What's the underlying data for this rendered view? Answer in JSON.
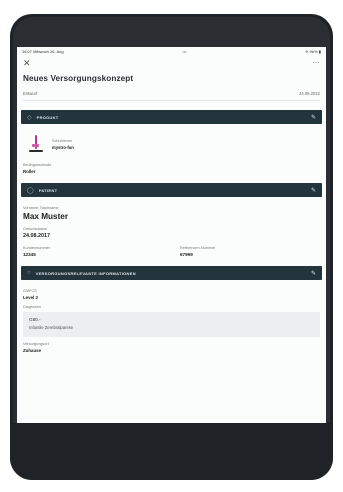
{
  "status_bar": {
    "left": "16:07  Mittwoch 26. Aug",
    "center": "•••",
    "right": "✈ 96% ▮"
  },
  "top_bar": {
    "close_glyph": "✕",
    "menu_glyph": "···"
  },
  "header": {
    "title": "Neues Versorgungskonzept",
    "left_meta": "Entwurf",
    "right_meta": "24.08.2022"
  },
  "sections": {
    "product": {
      "title": "PRODUKT",
      "icon": "cube-icon",
      "edit_glyph": "✎"
    },
    "patient": {
      "title": "PATIENT",
      "icon": "person-icon",
      "edit_glyph": "✎"
    },
    "care": {
      "title": "VERSORGUNGSRELEVANTE INFORMATIONEN",
      "icon": "info-icon",
      "edit_glyph": "✎"
    }
  },
  "product": {
    "label": "Schuhrexen",
    "value": "mystro-fun",
    "field_label": "Bedingunsimode",
    "field_value": "Roller"
  },
  "patient": {
    "name_label": "Vorname, Nachname",
    "name_value": "Max Muster",
    "birth_label": "Geburtsdatum",
    "birth_value": "24.08.2017",
    "id_label": "Kundennummer",
    "id_value": "12345",
    "ref_label": "Referenzen-Nummer",
    "ref_value": "67999"
  },
  "care": {
    "level_label": "GMFCS",
    "level_value": "Level 2",
    "diag_label": "Diagnosen",
    "diag_line1": "G80.-",
    "diag_line2": "Infantile Zerebralparese",
    "place_label": "Versorgungsort",
    "place_value": "Zuhause"
  }
}
